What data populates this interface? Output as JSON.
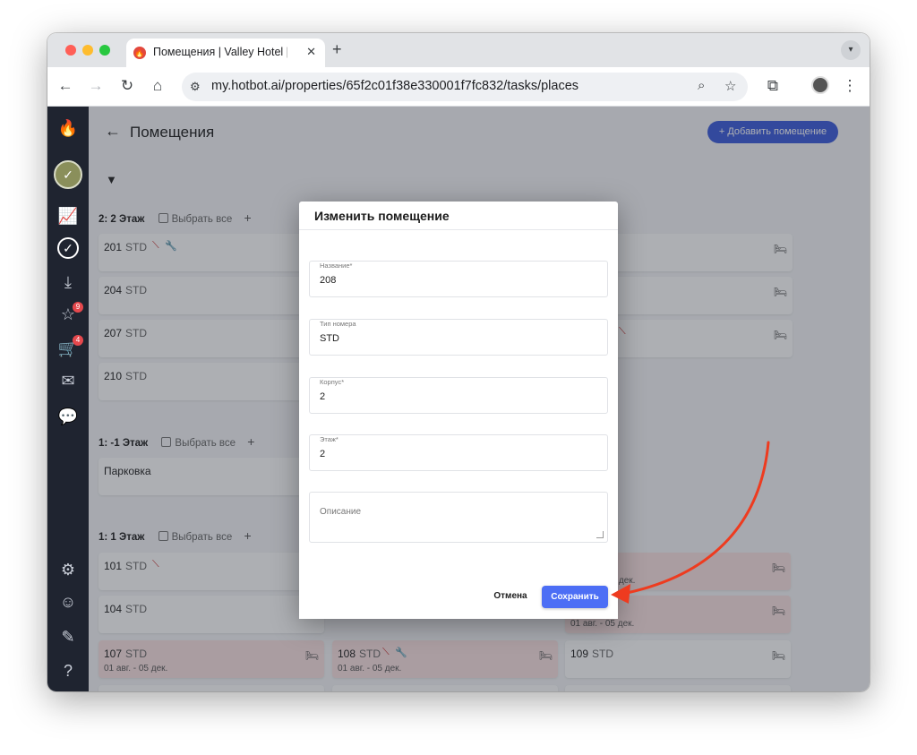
{
  "browser": {
    "tab_title": "Помещения | Valley Hotel | H",
    "tab_favicon": "🔥",
    "url": "my.hotbot.ai/properties/65f2c01f38e330001f7fc832/tasks/places",
    "traffic_lights": [
      "#ff5f57",
      "#febc2e",
      "#28c840"
    ]
  },
  "app": {
    "page_title": "Помещения",
    "add_button": "+ Добавить помещение",
    "accent_color": "#3b5bdb"
  },
  "sidebar": {
    "badges": {
      "inbox": "9",
      "cart": "4"
    }
  },
  "groups": [
    {
      "title": "2: 2 Этаж",
      "select_all": "Выбрать все",
      "cards": [
        {
          "number": "201",
          "type": "STD"
        },
        {
          "number": "204",
          "type": "STD"
        },
        {
          "number": "207",
          "type": "STD"
        },
        {
          "number": "210",
          "type": "STD"
        }
      ]
    },
    {
      "title": "1: -1 Этаж",
      "select_all": "Выбрать все",
      "cards": [
        {
          "number": "Парковка",
          "type": ""
        }
      ]
    },
    {
      "title": "1: 1 Этаж",
      "select_all": "Выбрать все",
      "cards": [
        {
          "number": "101",
          "type": "STD"
        },
        {
          "number": "104",
          "type": "STD"
        },
        {
          "number": "107",
          "type": "STD",
          "dates": "01 авг. - 05 дек."
        },
        {
          "number": "108",
          "type": "STD",
          "dates": "01 авг. - 05 дек."
        },
        {
          "number": "109",
          "type": "STD"
        }
      ],
      "partial_dates": [
        "05 дек.",
        "01 авг. - 05 дек."
      ]
    }
  ],
  "modal": {
    "title": "Изменить помещение",
    "fields": [
      {
        "label": "Название*",
        "value": "208"
      },
      {
        "label": "Тип номера",
        "value": "STD"
      },
      {
        "label": "Корпус*",
        "value": "2"
      },
      {
        "label": "Этаж*",
        "value": "2"
      }
    ],
    "description_placeholder": "Описание",
    "cancel": "Отмена",
    "save": "Сохранить"
  }
}
